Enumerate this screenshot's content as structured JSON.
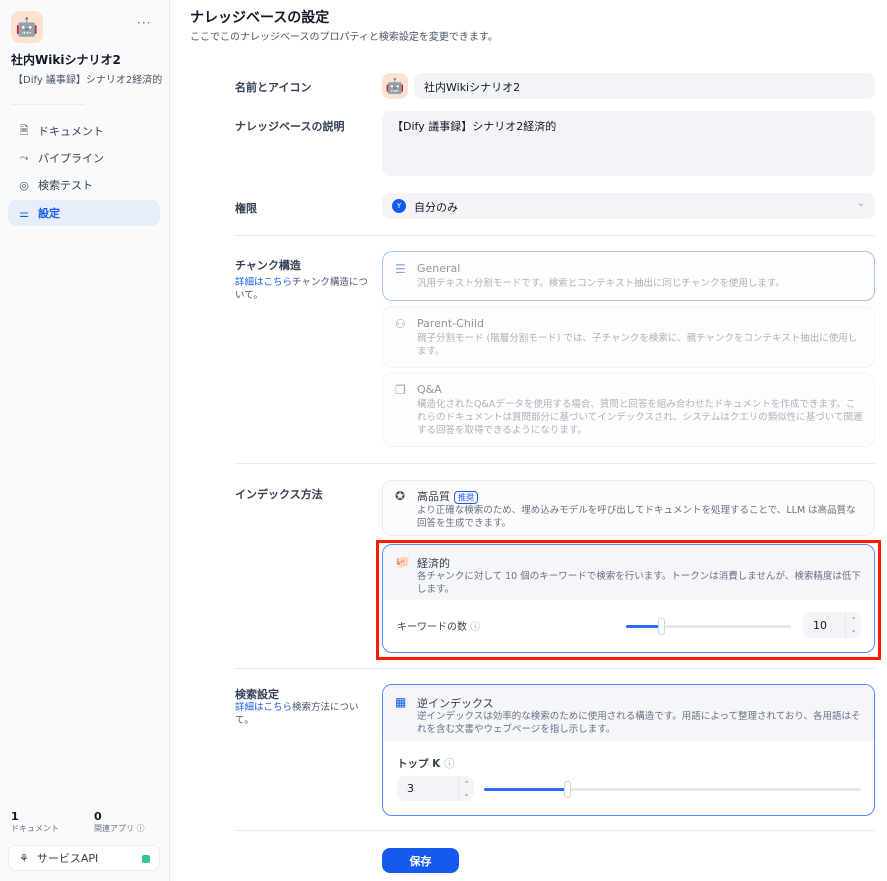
{
  "sidebar": {
    "kb_name": "社内Wikiシナリオ2",
    "kb_desc": "【Dify 議事録】シナリオ2経済的",
    "more": "···",
    "nav": [
      {
        "label": "ドキュメント",
        "icon": "document-icon"
      },
      {
        "label": "パイプライン",
        "icon": "pipeline-icon"
      },
      {
        "label": "検索テスト",
        "icon": "target-icon"
      },
      {
        "label": "設定",
        "icon": "settings-icon"
      }
    ],
    "stats": {
      "docs_count": "1",
      "docs_label": "ドキュメント",
      "apps_count": "0",
      "apps_label": "関連アプリ"
    },
    "service_api": "サービスAPI"
  },
  "header": {
    "title": "ナレッジベースの設定",
    "subtitle": "ここでこのナレッジベースのプロパティと検索設定を変更できます。"
  },
  "form": {
    "name_label": "名前とアイコン",
    "name_value": "社内Wikiシナリオ2",
    "desc_label": "ナレッジベースの説明",
    "desc_value": "【Dify 議事録】シナリオ2経済的",
    "perm_label": "権限",
    "perm_value": "自分のみ",
    "perm_avatar": "Y",
    "chunk_label": "チャンク構造",
    "chunk_link": "詳細はこちら",
    "chunk_help": "チャンク構造について。",
    "chunk_options": [
      {
        "title": "General",
        "desc": "汎用テキスト分割モードです。検索とコンテキスト抽出に同じチャンクを使用します。"
      },
      {
        "title": "Parent-Child",
        "desc": "親子分割モード (階層分割モード) では、子チャンクを検索に、親チャンクをコンテキスト抽出に使用します。"
      },
      {
        "title": "Q&A",
        "desc": "構造化されたQ&Aデータを使用する場合、質問と回答を組み合わせたドキュメントを作成できます。これらのドキュメントは質問部分に基づいてインデックスされ、システムはクエリの類似性に基づいて関連する回答を取得できるようになります。"
      }
    ],
    "index_label": "インデックス方法",
    "hq_title": "高品質",
    "hq_badge": "推奨",
    "hq_desc": "より正確な検索のため、埋め込みモデルを呼び出してドキュメントを処理することで、LLM は高品質な回答を生成できます。",
    "eco_title": "経済的",
    "eco_desc": "各チャンクに対して 10 個のキーワードで検索を行います。トークンは消費しませんが、検索精度は低下します。",
    "keyword_label": "キーワードの数",
    "keyword_value": "10",
    "keyword_fraction": 0.21,
    "search_label": "検索設定",
    "search_link": "詳細はこちら",
    "search_help": "検索方法について。",
    "inv_title": "逆インデックス",
    "inv_desc": "逆インデックスは効率的な検索のために使用される構造です。用語によって整理されており、各用語はそれを含む文書やウェブページを指し示します。",
    "topk_label": "トップ K",
    "topk_value": "3",
    "topk_fraction": 0.22,
    "save": "保存"
  },
  "colors": {
    "accent": "#155aef",
    "highlight": "#ff1a00"
  }
}
